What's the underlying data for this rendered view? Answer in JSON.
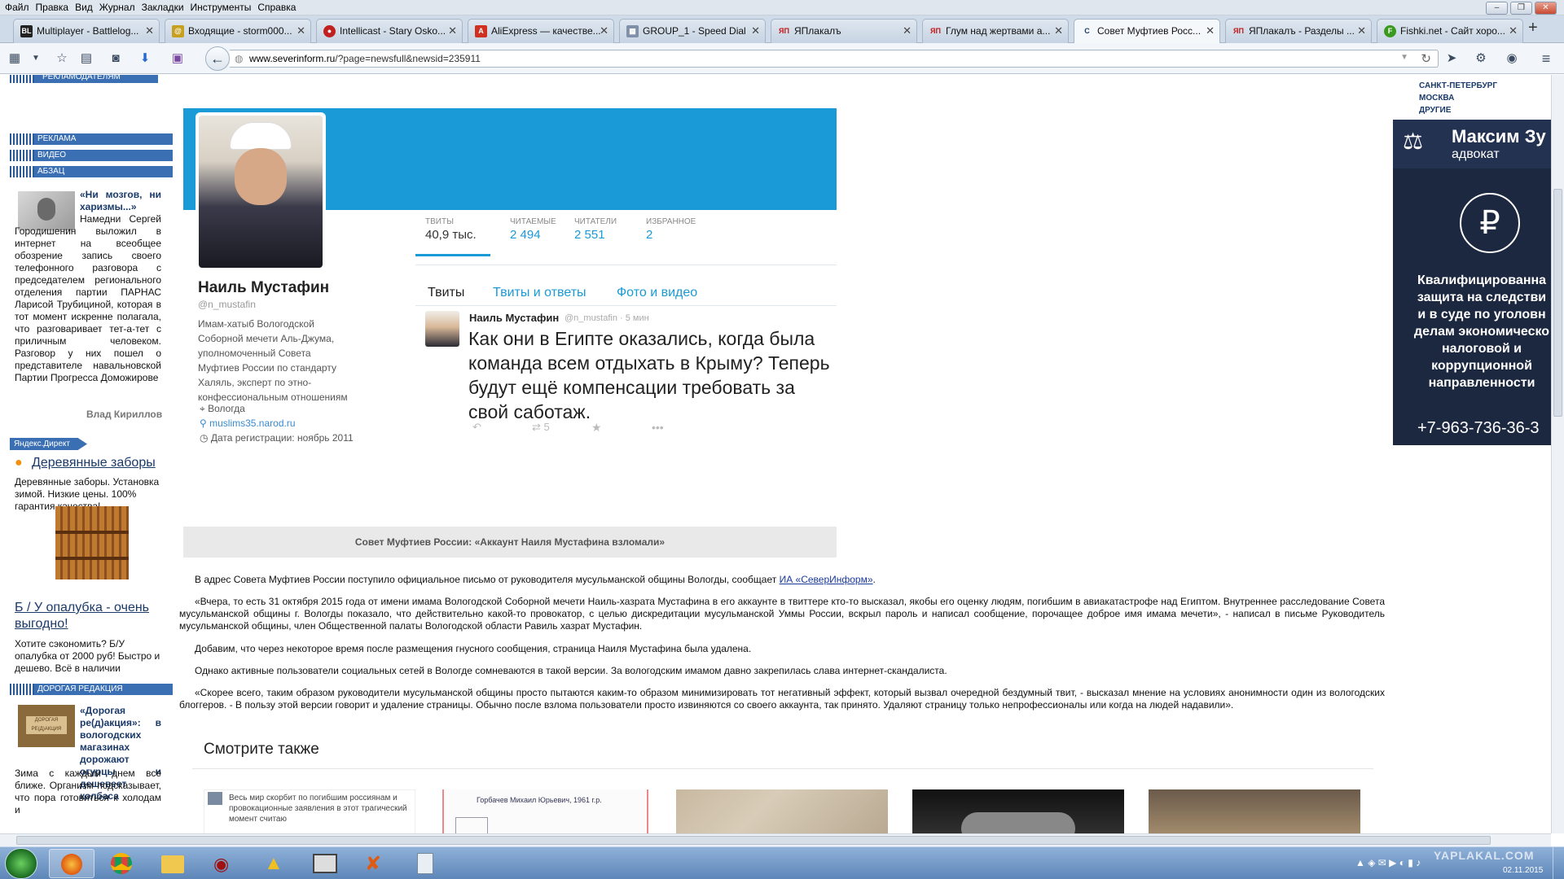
{
  "menu": [
    "Файл",
    "Правка",
    "Вид",
    "Журнал",
    "Закладки",
    "Инструменты",
    "Справка"
  ],
  "tabs": [
    {
      "title": "Multiplayer - Battlelog...",
      "icon": "BL",
      "color": "#222"
    },
    {
      "title": "Входящие - storm000...",
      "icon": "@",
      "color": "#c8a020"
    },
    {
      "title": "Intellicast - Stary Osko...",
      "icon": "●",
      "color": "#c02020"
    },
    {
      "title": "AliExpress — качестве...",
      "icon": "A",
      "color": "#d03020"
    },
    {
      "title": "GROUP_1 - Speed Dial",
      "icon": "▦",
      "color": "#8090a8"
    },
    {
      "title": "ЯПлакалъ",
      "icon": "ЯП",
      "color": "#c01818"
    },
    {
      "title": "Глум над жертвами а...",
      "icon": "ЯП",
      "color": "#c01818"
    },
    {
      "title": "Совет Муфтиев Росс...",
      "icon": "С",
      "color": "#1a3a6a"
    },
    {
      "title": "ЯПлакалъ - Разделы ...",
      "icon": "ЯП",
      "color": "#c01818"
    },
    {
      "title": "Fishki.net - Сайт хоро...",
      "icon": "F",
      "color": "#3a9a20"
    }
  ],
  "url": {
    "domain": "www.severinform.ru",
    "path": "/?page=newsfull&newsid=235911"
  },
  "sidebar": {
    "top_section": "РЕКЛАМОДАТЕЛЯМ",
    "sections": [
      "РЕКЛАМА",
      "ВИДЕО",
      "АБЗАЦ"
    ],
    "abzac": {
      "title": "«Ни мозгов, ни харизмы...»",
      "text": "Намедни Сергей Городишенин выложил в интернет на всеобщее обозрение запись своего телефонного разговора с председателем регионального отделения партии ПАРНАС Ларисой Трубициной, которая в тот момент искренне полагала, что разговаривает тет-а-тет с приличным человеком. Разговор у них пошел о представителе навальновской Партии Прогресса Доможирове",
      "author": "Влад Кириллов"
    },
    "direct_label": "Яндекс.Директ",
    "ad1_title": "Деревянные заборы",
    "ad1_text": "Деревянные заборы. Установка зимой. Низкие цены. 100% гарантия качества!",
    "ad2_title": "Б / У опалубка - очень выгодно!",
    "ad2_text": "Хотите сэкономить? Б/У опалубка от 2000 руб! Быстро и дешево. Всё в наличии",
    "section2": "ДОРОГАЯ РЕДАКЦИЯ",
    "redak_title": "«Дорогая ре(д)акция»: в вологодских магазинах дорожают огурцы и дешевеет колбаса",
    "redak_text": "Зима с каждым днем все ближе. Организм подсказывает, что пора готовиться к холодам и"
  },
  "twitter": {
    "name": "Наиль Мустафин",
    "handle": "@n_mustafin",
    "bio": "Имам-хатыб Вологодской Соборной мечети Аль-Джума, уполномоченный Совета Муфтиев России по стандарту Халяль, эксперт по этно-конфессиональным отношениям",
    "location": "Вологда",
    "site": "muslims35.narod.ru",
    "joined": "Дата регистрации: ноябрь 2011",
    "stats": [
      {
        "label": "ТВИТЫ",
        "value": "40,9 тыс."
      },
      {
        "label": "ЧИТАЕМЫЕ",
        "value": "2 494"
      },
      {
        "label": "ЧИТАТЕЛИ",
        "value": "2 551"
      },
      {
        "label": "ИЗБРАННОЕ",
        "value": "2"
      }
    ],
    "tabs": [
      "Твиты",
      "Твиты и ответы",
      "Фото и видео"
    ],
    "tweet_author": "Наиль Мустафин",
    "tweet_meta": "@n_mustafin · 5 мин",
    "tweet_text": "Как они в Египте оказались, когда была команда всем отдыхать в Крыму? Теперь будут ещё компенсации требовать за свой саботаж.",
    "retweets": "5"
  },
  "article": {
    "caption": "Совет Муфтиев России: «Аккаунт Наиля Мустафина взломали»",
    "p1": "В адрес Совета Муфтиев России поступило официальное письмо от руководителя мусульманской общины Вологды, сообщает",
    "p1_link": "ИА «СеверИнформ»",
    "p2": "«Вчера, то есть 31 октября 2015 года от имени имама Вологодской Соборной мечети Наиль-хазрата Мустафина в его аккаунте в твиттере кто-то высказал, якобы его оценку людям, погибшим в авиакатастрофе над Египтом. Внутреннее расследование Совета мусульманской общины г. Вологды показало, что действительно какой-то провокатор, с целью дискредитации мусульманской Уммы России, вскрыл пароль и написал сообщение, порочащее доброе имя имама мечети», - написал в письме Руководитель мусульманской общины, член Общественной палаты Вологодской области Равиль хазрат Мустафин.",
    "p3": "Добавим, что через некоторое время после размещения гнусного сообщения, страница Наиля Мустафина была удалена.",
    "p4": "Однако активные пользователи социальных сетей в Вологде сомневаются в такой версии. За вологодским имамом давно закрепилась слава интернет-скандалиста.",
    "p5": "«Скорее всего, таким образом руководители мусульманской общины просто пытаются каким-то образом минимизировать тот негативный эффект, который вызвал очередной бездумный твит, - высказал мнение на условиях анонимности один из вологодских блоггеров. - В пользу этой версии говорит и удаление страницы. Обычно после взлома пользователи просто извиняются со своего аккаунта, так принято. Удаляют страницу только непрофессионалы или когда на людей надавили».",
    "see_also": "Смотрите также",
    "thumb1_text": "Весь мир скорбит по погибшим россиянам и провокационные заявления в этот трагический момент считаю",
    "thumb2_text": "Горбачев Михаил Юрьевич, 1961 г.р."
  },
  "right": {
    "cities": [
      "САНКТ-ПЕТЕРБУРГ",
      "МОСКВА",
      "ДРУГИЕ"
    ],
    "ad_name": "Максим Зу",
    "ad_role": "адвокат",
    "ad_text": "Квалифицированна защита на следстви и в суде по уголовн делам экономическо налоговой и коррупционной направленности",
    "ad_phone": "+7-963-736-36-3"
  },
  "taskbar": {
    "date": "02.11.2015",
    "watermark": "YAPLAKAL.COM"
  }
}
